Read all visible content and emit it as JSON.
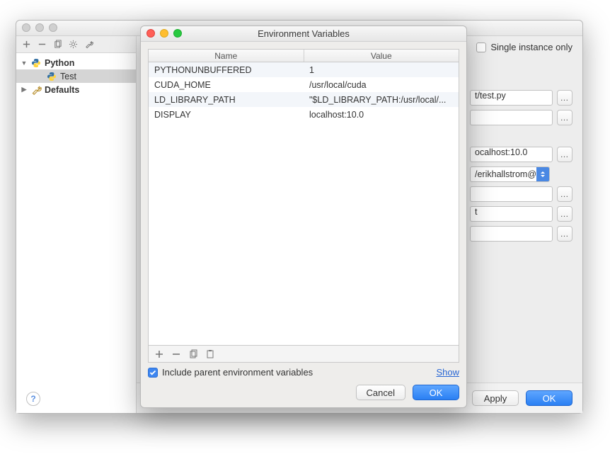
{
  "back_window": {
    "sidebar": {
      "toolbar_icons": [
        "plus-icon",
        "minus-icon",
        "copy-icon",
        "gear-icon",
        "wrench-icon"
      ],
      "items": [
        {
          "label": "Python",
          "bold": true,
          "expanded": true,
          "selected": false,
          "icon": "python"
        },
        {
          "label": "Test",
          "bold": false,
          "expanded": null,
          "selected": true,
          "icon": "python"
        },
        {
          "label": "Defaults",
          "bold": true,
          "expanded": false,
          "selected": false,
          "icon": "wrench"
        }
      ]
    },
    "right": {
      "single_instance_label": "Single instance only",
      "fields": [
        {
          "value": "t/test.py",
          "ellipsis": true,
          "type": "input"
        },
        {
          "value": "",
          "ellipsis": true,
          "type": "input"
        },
        {
          "value": "ocalhost:10.0",
          "ellipsis": true,
          "type": "input"
        },
        {
          "value": "/erikhallstrom@",
          "type": "select"
        },
        {
          "value": "",
          "ellipsis": true,
          "type": "input"
        },
        {
          "value": "t",
          "ellipsis": true,
          "type": "input"
        },
        {
          "value": "",
          "ellipsis": true,
          "type": "input"
        }
      ],
      "footer": {
        "apply": "Apply",
        "ok": "OK"
      }
    }
  },
  "front_window": {
    "title": "Environment Variables",
    "columns": [
      "Name",
      "Value"
    ],
    "rows": [
      {
        "name": "PYTHONUNBUFFERED",
        "value": "1"
      },
      {
        "name": "CUDA_HOME",
        "value": "/usr/local/cuda"
      },
      {
        "name": "LD_LIBRARY_PATH",
        "value": "\"$LD_LIBRARY_PATH:/usr/local/..."
      },
      {
        "name": "DISPLAY",
        "value": "localhost:10.0"
      }
    ],
    "include_label": "Include parent environment variables",
    "show_link": "Show",
    "cancel": "Cancel",
    "ok": "OK"
  }
}
